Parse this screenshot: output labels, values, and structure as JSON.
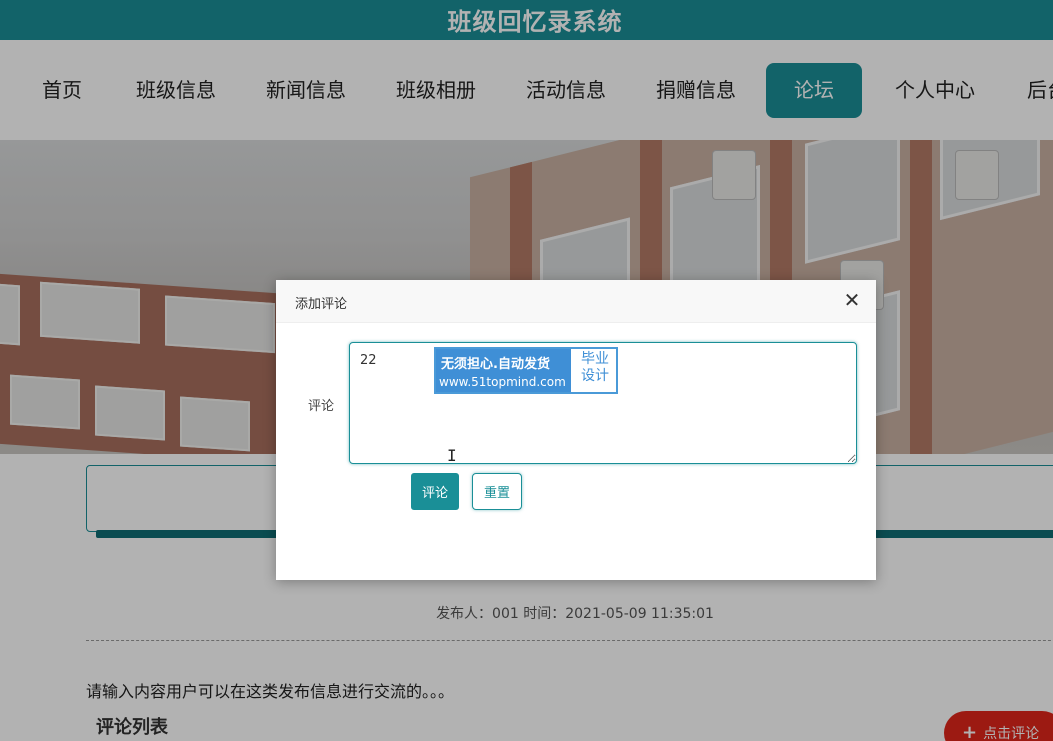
{
  "header": {
    "title": "班级回忆录系统"
  },
  "nav": {
    "items": [
      {
        "label": "首页"
      },
      {
        "label": "班级信息"
      },
      {
        "label": "新闻信息"
      },
      {
        "label": "班级相册"
      },
      {
        "label": "活动信息"
      },
      {
        "label": "捐赠信息"
      },
      {
        "label": "论坛",
        "active": true
      },
      {
        "label": "个人中心"
      },
      {
        "label": "后台"
      }
    ]
  },
  "post": {
    "meta": "发布人：001 时间：2021-05-09 11:35:01",
    "content": "请输入内容用户可以在这类发布信息进行交流的。。。",
    "comment_list_title": "评论列表"
  },
  "fab": {
    "label": "点击评论"
  },
  "modal": {
    "title": "添加评论",
    "field_label": "评论",
    "textarea_value": "22",
    "submit_label": "评论",
    "reset_label": "重置"
  },
  "watermark": {
    "line1": "无须担心.自动发货",
    "line2": "www.51topmind.com",
    "side": "毕业设计"
  },
  "colors": {
    "brand": "#1a8f97",
    "accent": "#e0261b"
  }
}
